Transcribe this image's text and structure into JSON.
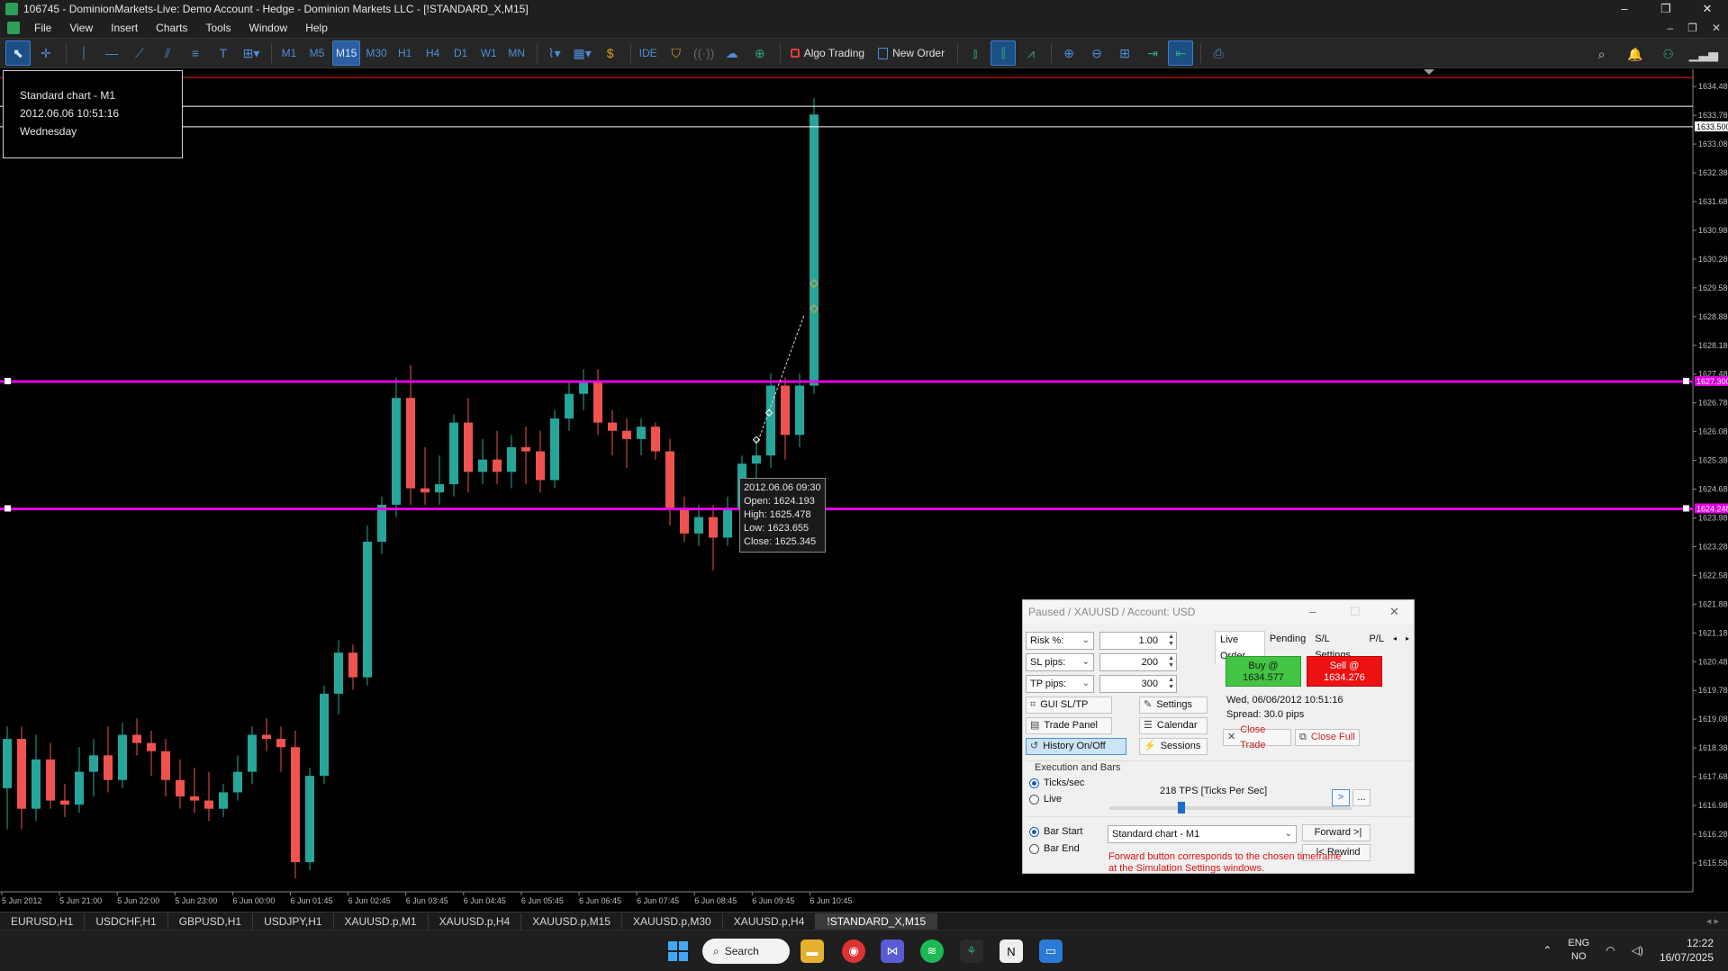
{
  "window": {
    "title": "106745 - DominionMarkets-Live: Demo Account - Hedge - Dominion Markets LLC - [!STANDARD_X,M15]",
    "controls": [
      "–",
      "❐",
      "✕"
    ]
  },
  "menu": [
    "File",
    "View",
    "Insert",
    "Charts",
    "Tools",
    "Window",
    "Help"
  ],
  "toolbar": {
    "timeframes": [
      "M1",
      "M5",
      "M15",
      "M30",
      "H1",
      "H4",
      "D1",
      "W1",
      "MN"
    ],
    "active_timeframe": "M15",
    "ide_label": "IDE",
    "algo_trading_label": "Algo Trading",
    "new_order_label": "New Order"
  },
  "infobox": {
    "line1": "Standard chart - M1",
    "line2": "2012.06.06 10:51:16",
    "line3": "Wednesday"
  },
  "tooltip": {
    "time": "2012.06.06 09:30",
    "open": "Open: 1624.193",
    "high": "High: 1625.478",
    "low": "Low: 1623.655",
    "close": "Close: 1625.345"
  },
  "chart_data": {
    "type": "candlestick",
    "symbol": "!STANDARD_X",
    "timeframe": "M15",
    "ylim": [
      1614.9,
      1634.9
    ],
    "price_ticks": [
      "1634.480",
      "1633.780",
      "1633.080",
      "1632.380",
      "1631.680",
      "1630.980",
      "1630.280",
      "1629.580",
      "1628.880",
      "1628.180",
      "1627.480",
      "1626.780",
      "1626.080",
      "1625.380",
      "1624.680",
      "1623.980",
      "1623.280",
      "1622.580",
      "1621.880",
      "1621.180",
      "1620.480",
      "1619.780",
      "1619.080",
      "1618.380",
      "1617.680",
      "1616.980",
      "1616.280",
      "1615.580"
    ],
    "time_ticks": [
      "5 Jun 2012",
      "5 Jun 21:00",
      "5 Jun 22:00",
      "5 Jun 23:00",
      "6 Jun 00:00",
      "6 Jun 01:45",
      "6 Jun 02:45",
      "6 Jun 03:45",
      "6 Jun 04:45",
      "6 Jun 05:45",
      "6 Jun 06:45",
      "6 Jun 07:45",
      "6 Jun 08:45",
      "6 Jun 09:45",
      "6 Jun 10:45"
    ],
    "horizontal_lines": [
      {
        "price": 1634.7,
        "color": "#ff2020",
        "label": ""
      },
      {
        "price": 1634.0,
        "color": "#ffffff",
        "label": ""
      },
      {
        "price": 1633.5,
        "color": "#ffffff",
        "label": "1633.500"
      },
      {
        "price": 1627.3,
        "color": "#e100e1",
        "label": "1627.300"
      },
      {
        "price": 1624.2,
        "color": "#e100e1",
        "label": "1624.248"
      }
    ],
    "bull_color": "#26a69a",
    "bear_color": "#ef5350",
    "candles": [
      [
        1617.8,
        1618.6,
        1615.6,
        1615.9
      ],
      [
        1615.9,
        1617.9,
        1615.6,
        1617.4
      ],
      [
        1617.4,
        1618.9,
        1616.4,
        1618.6
      ],
      [
        1618.6,
        1618.9,
        1616.4,
        1616.9
      ],
      [
        1616.9,
        1618.7,
        1616.6,
        1618.1
      ],
      [
        1618.1,
        1618.5,
        1616.9,
        1617.1
      ],
      [
        1617.1,
        1617.5,
        1616.7,
        1617.0
      ],
      [
        1617.0,
        1618.4,
        1616.8,
        1617.8
      ],
      [
        1617.8,
        1618.6,
        1617.2,
        1618.2
      ],
      [
        1618.2,
        1618.9,
        1617.3,
        1617.6
      ],
      [
        1617.6,
        1619.0,
        1617.4,
        1618.7
      ],
      [
        1618.7,
        1619.1,
        1618.2,
        1618.5
      ],
      [
        1618.5,
        1618.8,
        1617.7,
        1618.3
      ],
      [
        1618.3,
        1618.6,
        1617.2,
        1617.6
      ],
      [
        1617.6,
        1618.1,
        1616.9,
        1617.2
      ],
      [
        1617.2,
        1617.9,
        1616.8,
        1617.1
      ],
      [
        1617.1,
        1617.8,
        1616.6,
        1616.9
      ],
      [
        1616.9,
        1617.5,
        1616.7,
        1617.3
      ],
      [
        1617.3,
        1618.2,
        1617.1,
        1617.8
      ],
      [
        1617.8,
        1618.9,
        1617.5,
        1618.7
      ],
      [
        1618.7,
        1619.1,
        1618.3,
        1618.6
      ],
      [
        1618.6,
        1618.9,
        1617.8,
        1618.4
      ],
      [
        1618.4,
        1618.8,
        1615.2,
        1615.6
      ],
      [
        1615.6,
        1617.9,
        1615.4,
        1617.7
      ],
      [
        1617.7,
        1619.9,
        1617.5,
        1619.7
      ],
      [
        1619.7,
        1621.0,
        1619.2,
        1620.7
      ],
      [
        1620.7,
        1620.9,
        1619.8,
        1620.1
      ],
      [
        1620.1,
        1623.8,
        1619.9,
        1623.4
      ],
      [
        1623.4,
        1624.5,
        1623.1,
        1624.3
      ],
      [
        1624.3,
        1627.4,
        1624.0,
        1626.9
      ],
      [
        1626.9,
        1627.7,
        1624.3,
        1624.7
      ],
      [
        1624.7,
        1625.7,
        1624.3,
        1624.6
      ],
      [
        1624.6,
        1625.5,
        1624.3,
        1624.8
      ],
      [
        1624.8,
        1626.5,
        1624.5,
        1626.3
      ],
      [
        1626.3,
        1626.9,
        1624.6,
        1625.1
      ],
      [
        1625.1,
        1625.9,
        1624.8,
        1625.4
      ],
      [
        1625.4,
        1626.1,
        1624.8,
        1625.1
      ],
      [
        1625.1,
        1626.0,
        1624.7,
        1625.7
      ],
      [
        1625.7,
        1626.2,
        1624.8,
        1625.6
      ],
      [
        1625.6,
        1626.1,
        1624.6,
        1624.9
      ],
      [
        1624.9,
        1626.6,
        1624.7,
        1626.4
      ],
      [
        1626.4,
        1627.3,
        1626.1,
        1627.0
      ],
      [
        1627.0,
        1627.6,
        1626.6,
        1627.3
      ],
      [
        1627.3,
        1627.6,
        1626.0,
        1626.3
      ],
      [
        1626.3,
        1626.6,
        1625.5,
        1626.1
      ],
      [
        1626.1,
        1626.4,
        1625.2,
        1625.9
      ],
      [
        1625.9,
        1626.4,
        1625.5,
        1626.2
      ],
      [
        1626.2,
        1626.3,
        1625.4,
        1625.6
      ],
      [
        1625.6,
        1625.9,
        1623.8,
        1624.2
      ],
      [
        1624.2,
        1624.5,
        1623.4,
        1623.6
      ],
      [
        1623.6,
        1624.3,
        1623.3,
        1624.0
      ],
      [
        1624.0,
        1624.3,
        1622.7,
        1623.5
      ],
      [
        1623.5,
        1624.5,
        1623.3,
        1624.2
      ],
      [
        1624.2,
        1625.5,
        1623.7,
        1625.3
      ],
      [
        1625.3,
        1625.9,
        1624.1,
        1625.5
      ],
      [
        1625.5,
        1627.5,
        1625.2,
        1627.2
      ],
      [
        1627.2,
        1627.4,
        1625.4,
        1626.0
      ],
      [
        1626.0,
        1627.5,
        1625.7,
        1627.2
      ],
      [
        1627.2,
        1634.2,
        1627.0,
        1633.8
      ]
    ]
  },
  "symbol_tabs": [
    "EURUSD,H1",
    "USDCHF,H1",
    "GBPUSD,H1",
    "USDJPY,H1",
    "XAUUSD.p,M1",
    "XAUUSD.p,H4",
    "XAUUSD.p,M15",
    "XAUUSD.p,M30",
    "XAUUSD.p,H4",
    "!STANDARD_X,M15"
  ],
  "active_symbol_tab": "!STANDARD_X,M15",
  "sim_panel": {
    "title": "Paused / XAUUSD / Account: USD",
    "risk_label": "Risk %:",
    "risk_value": "1.00",
    "sl_label": "SL pips:",
    "sl_value": "200",
    "tp_label": "TP pips:",
    "tp_value": "300",
    "tabs": [
      "Live Order",
      "Pending",
      "S/L Settings",
      "P/L"
    ],
    "buy_label": "Buy @",
    "buy_price": "1634.577",
    "sell_label": "Sell @",
    "sell_price": "1634.276",
    "datetime": "Wed, 06/06/2012  10:51:16",
    "spread": "Spread: 30.0 pips",
    "btn_gui_sltp": "GUI SL/TP",
    "btn_settings": "Settings",
    "btn_trade_panel": "Trade Panel",
    "btn_calendar": "Calendar",
    "btn_history": "History On/Off",
    "btn_sessions": "Sessions",
    "btn_close_trade": "Close Trade",
    "btn_close_full": "Close Full",
    "exec_heading": "Execution and Bars",
    "radio_ticks": "Ticks/sec",
    "radio_live": "Live",
    "tps_label": "218 TPS [Ticks Per Sec]",
    "tps_slider_fraction": 0.29,
    "btn_play": ">",
    "btn_more": "...",
    "radio_bar_start": "Bar Start",
    "radio_bar_end": "Bar End",
    "chart_select": "Standard chart - M1",
    "btn_forward": "Forward >|",
    "btn_rewind": "|< Rewind",
    "warning_line1": "Forward button corresponds to the chosen timeframe",
    "warning_line2": "at the Simulation Settings windows."
  },
  "taskbar": {
    "search_label": "Search",
    "lang_line1": "ENG",
    "lang_line2": "NO",
    "time": "12:22",
    "date": "16/07/2025"
  }
}
